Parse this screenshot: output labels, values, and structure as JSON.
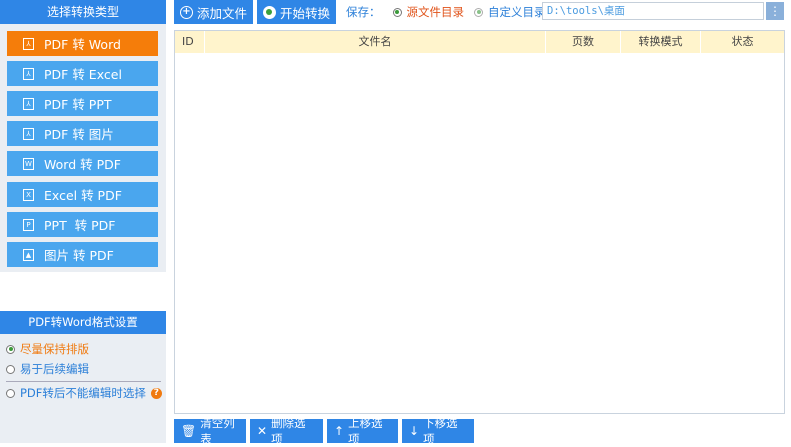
{
  "sidebar": {
    "header": "选择转换类型",
    "items": [
      {
        "label": "PDF 转 Word",
        "icon": "pdf-icon",
        "active": true
      },
      {
        "label": "PDF 转 Excel",
        "icon": "pdf-icon"
      },
      {
        "label": "PDF 转 PPT",
        "icon": "pdf-icon"
      },
      {
        "label": "PDF 转 图片",
        "icon": "pdf-icon"
      },
      {
        "label": "Word 转 PDF",
        "icon": "word-icon"
      },
      {
        "label": "Excel 转 PDF",
        "icon": "excel-icon"
      },
      {
        "label": "PPT  转 PDF",
        "icon": "ppt-icon"
      },
      {
        "label": "图片 转 PDF",
        "icon": "image-icon"
      }
    ]
  },
  "settings": {
    "header": "PDF转Word格式设置",
    "options": [
      {
        "label": "尽量保持排版",
        "selected": true
      },
      {
        "label": "易于后续编辑",
        "selected": false
      },
      {
        "label": "PDF转后不能编辑时选择",
        "selected": false
      }
    ],
    "help": "?"
  },
  "toolbar": {
    "add_files": "添加文件",
    "start_convert": "开始转换",
    "save_label": "保存：",
    "save_options": [
      "源文件目录",
      "自定义目录"
    ],
    "path_value": "D:\\tools\\桌面",
    "browse": "⋮"
  },
  "table": {
    "columns": [
      "ID",
      "文件名",
      "页数",
      "转换模式",
      "状态"
    ]
  },
  "bottom": {
    "clear": "清空列表",
    "delete": "删除选项",
    "move_up": "上移选项",
    "move_down": "下移选项"
  },
  "colors": {
    "accent_blue": "#2f86e6",
    "button_blue": "#4aa6ee",
    "active_orange": "#f57d0a",
    "table_header": "#fff4cc"
  }
}
